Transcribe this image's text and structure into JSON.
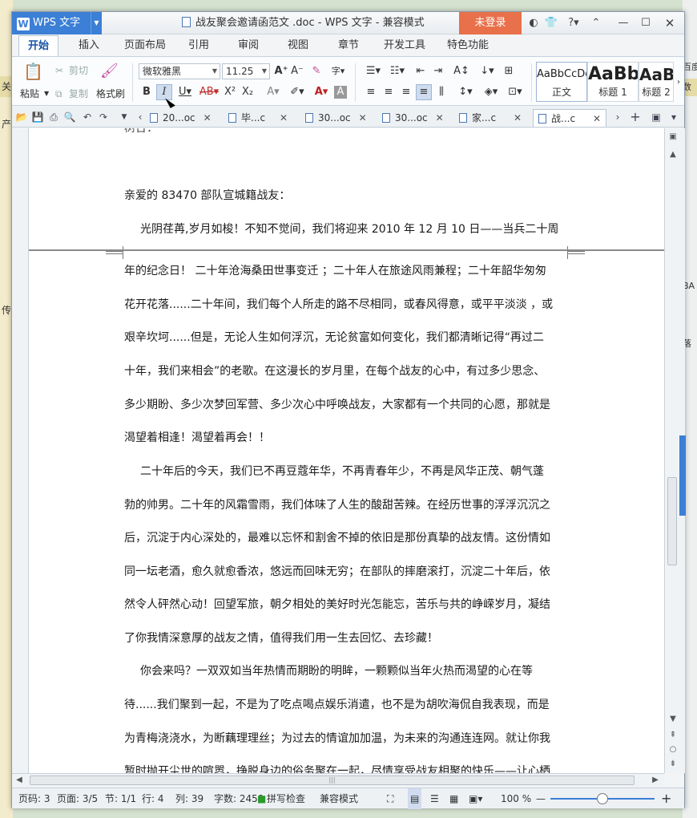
{
  "app": {
    "logo_letter": "W",
    "name": "WPS 文字",
    "title": "战友聚会邀请函范文 .doc - WPS 文字 - 兼容模式",
    "login": "未登录",
    "accent": "#3b7fd6",
    "login_color": "#e8704a"
  },
  "ribbon_tabs": [
    "开始",
    "插入",
    "页面布局",
    "引用",
    "审阅",
    "视图",
    "章节",
    "开发工具",
    "特色功能"
  ],
  "ribbon": {
    "paste": "粘贴",
    "cut": "剪切",
    "copy": "复制",
    "format_painter": "格式刷",
    "font_name": "微软雅黑",
    "font_size": "11.25",
    "styles": [
      {
        "preview": "AaBbCcDd",
        "name": "正文"
      },
      {
        "preview": "AaBb",
        "name": "标题 1"
      },
      {
        "preview": "AaB",
        "name": "标题 2"
      }
    ]
  },
  "doc_tabs": [
    {
      "label": "20...oc"
    },
    {
      "label": "毕...c"
    },
    {
      "label": "30...oc"
    },
    {
      "label": "30...oc"
    },
    {
      "label": "家...c"
    },
    {
      "label": "战...c",
      "active": true
    }
  ],
  "document": {
    "top_fragment": "树台：",
    "lines_before_break": [
      "亲爱的 83470 部队宣城籍战友：",
      "光阴荏苒,岁月如梭！不知不觉间，我们将迎来 2010 年 12 月 10 日——当兵二十周"
    ],
    "lines_after_break": [
      "年的纪念日！ 二十年沧海桑田世事变迁 ；二十年人在旅途风雨兼程；二十年韶华匆匆",
      "花开花落......二十年间，我们每个人所走的路不尽相同，或春风得意，或平平淡淡 ，或",
      "艰辛坎坷......但是，无论人生如何浮沉，无论贫富如何变化，我们都清晰记得“再过二",
      "十年，我们来相会”的老歌。在这漫长的岁月里，在每个战友的心中，有过多少思念、",
      "多少期盼、多少次梦回军营、多少次心中呼唤战友，大家都有一个共同的心愿，那就是",
      "渴望着相逢！渴望着再会！！",
      "二十年后的今天，我们已不再豆蔻年华，不再青春年少，不再是风华正茂、朝气蓬",
      "勃的帅男。二十年的风霜雪雨，我们体味了人生的酸甜苦辣。在经历世事的浮浮沉沉之",
      "后，沉淀于内心深处的，最难以忘怀和割舍不掉的依旧是那份真挚的战友情。这份情如",
      "同一坛老酒，愈久就愈香浓，悠远而回味无穷；在部队的摔磨滚打，沉淀二十年后，依",
      "然令人砰然心动！回望军旅，朝夕相处的美好时光怎能忘，苦乐与共的峥嵘岁月，凝结",
      "了你我情深意厚的战友之情，值得我们用一生去回忆、去珍藏！",
      "你会来吗？一双双如当年热情而期盼的明眸，一颗颗似当年火热而渴望的心在等",
      "待......我们聚到一起，不是为了吃点喝点娱乐消遣，也不是为胡吹海侃自我表现，而是",
      "为青梅浇浇水，为断藕理理丝；为过去的情谊加加温，为未来的沟通连连网。就让你我",
      "暂时抛开尘世的喧嚣，挣脱身边的俗务聚在一起，尽情享受战友相聚的快乐——让心栖"
    ]
  },
  "status": {
    "page_no": "页码: 3",
    "pages": "页面: 3/5",
    "section": "节: 1/1",
    "row": "行: 4",
    "col": "列: 39",
    "words": "字数: 2459",
    "spell": "拼写检查",
    "compat": "兼容模式",
    "zoom": "100 %",
    "zoom_fraction": 0.5
  },
  "background": {
    "left": [
      "关",
      "产",
      "传"
    ],
    "right": [
      "百度",
      "数",
      "BA",
      "落"
    ]
  }
}
